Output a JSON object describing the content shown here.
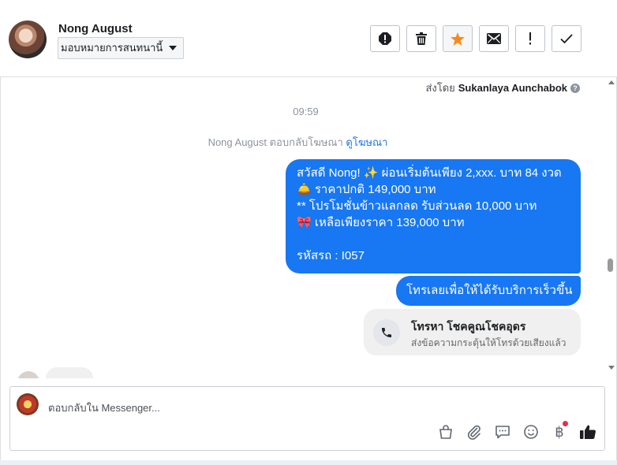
{
  "header": {
    "contact_name": "Nong August",
    "assign_label": "มอบหมายการสนทนานี้",
    "tool_icons": [
      "spam-icon",
      "trash-icon",
      "star-icon",
      "envelope-icon",
      "exclamation-icon",
      "checkmark-icon"
    ],
    "star_color": "#f68a1e"
  },
  "chat": {
    "sent_by_prefix": "ส่งโดย",
    "sent_by_name": "Sukanlaya Aunchabok",
    "help_glyph": "?",
    "time": "09:59",
    "replied_text": "Nong August ตอบกลับโฆษณา",
    "view_ad_link": "ดูโฆษณา",
    "message_lines": [
      "สวัสดี Nong! ✨  ผ่อนเริ่มต้นเพียง 2,xxx. บาท 84 งวด",
      "🛎️ ราคาปกติ 149,000 บาท",
      "** โปรโมชั่นข้าวแลกลด รับส่วนลด 10,000 บาท",
      "🎀  เหลือเพียงราคา 139,000 บาท",
      "",
      " รหัสรถ : I057"
    ],
    "message_2": "โทรเลยเพื่อให้ได้รับบริการเร็วขึ้น",
    "call_card": {
      "title": "โทรหา โชคคูณโชคอุดร",
      "subtitle": "ส่งข้อความกระตุ้นให้โทรด้วยเสียงแล้ว"
    },
    "bubble_color": "#1877f2"
  },
  "composer": {
    "placeholder": "ตอบกลับใน Messenger...",
    "icons": [
      "shopping-bag-icon",
      "paperclip-icon",
      "saved-reply-icon",
      "emoji-icon",
      "baht-payment-icon",
      "thumbs-up-icon"
    ],
    "baht_glyph": "฿",
    "notification_color": "#f02849"
  }
}
